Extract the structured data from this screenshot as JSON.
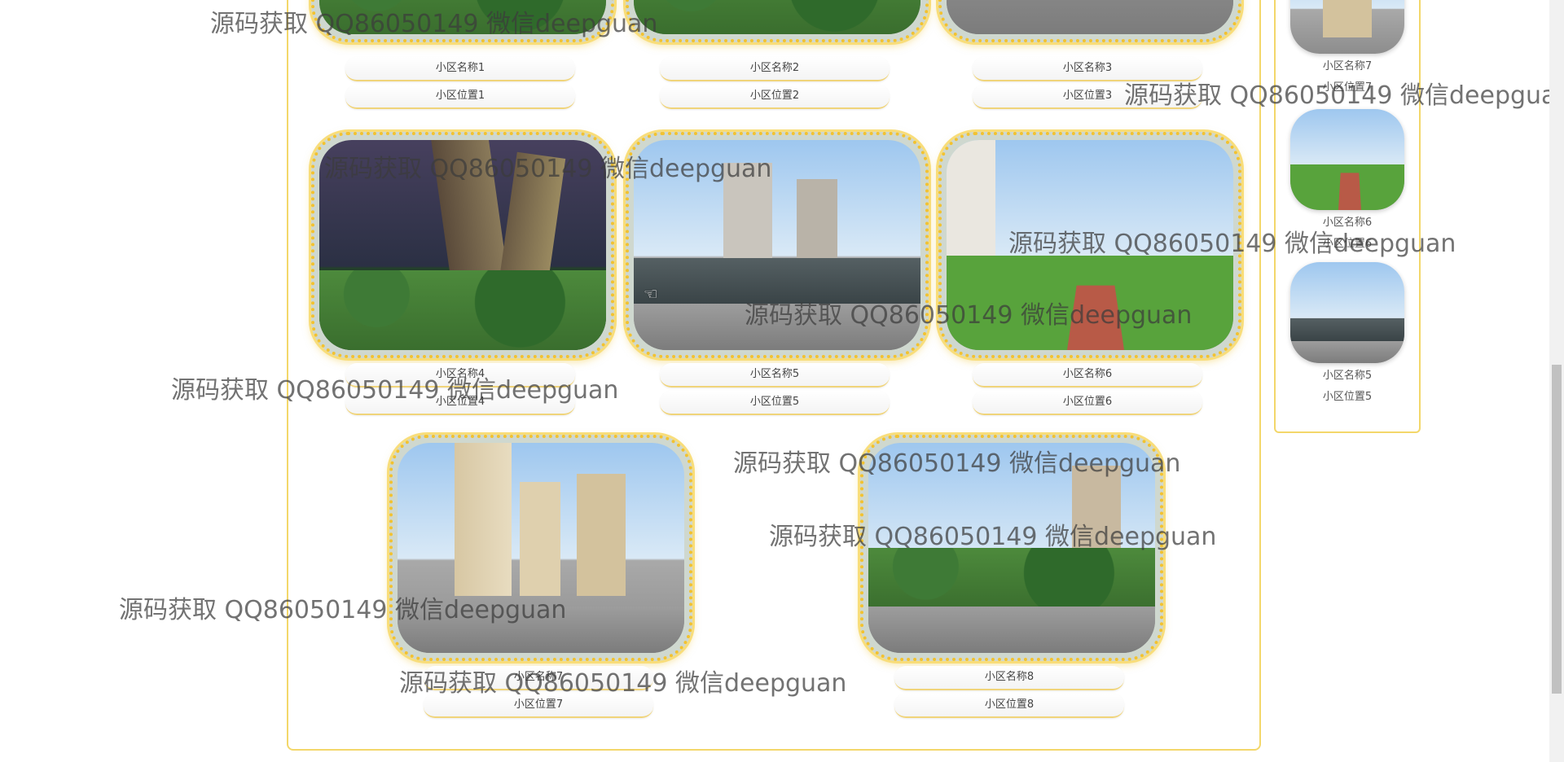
{
  "communities": [
    {
      "name": "小区名称1",
      "location": "小区位置1"
    },
    {
      "name": "小区名称2",
      "location": "小区位置2"
    },
    {
      "name": "小区名称3",
      "location": "小区位置3"
    },
    {
      "name": "小区名称4",
      "location": "小区位置4"
    },
    {
      "name": "小区名称5",
      "location": "小区位置5"
    },
    {
      "name": "小区名称6",
      "location": "小区位置6"
    },
    {
      "name": "小区名称7",
      "location": "小区位置7"
    },
    {
      "name": "小区名称8",
      "location": "小区位置8"
    }
  ],
  "sidebar": {
    "items": [
      {
        "name": "小区名称7",
        "location": "小区位置7"
      },
      {
        "name": "小区名称6",
        "location": "小区位置6"
      },
      {
        "name": "小区名称5",
        "location": "小区位置5"
      }
    ]
  },
  "watermark": {
    "text": "源码获取 QQ86050149 微信deepguan",
    "text_partial": "源码获取 QQ86050149 微信deepguan"
  },
  "colors": {
    "accent_border": "#f3d76a",
    "photo_frame": "#f2c230"
  }
}
